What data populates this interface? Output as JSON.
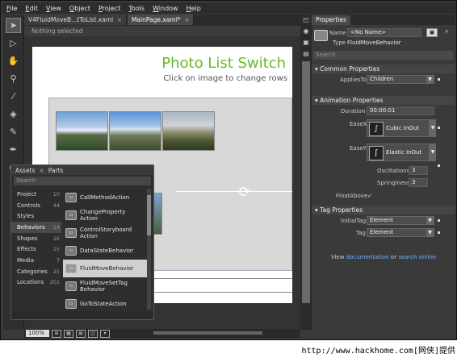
{
  "menubar": {
    "items": [
      {
        "key": "F",
        "rest": "ile"
      },
      {
        "key": "E",
        "rest": "dit"
      },
      {
        "key": "V",
        "rest": "iew"
      },
      {
        "key": "O",
        "rest": "bject"
      },
      {
        "key": "P",
        "rest": "roject"
      },
      {
        "key": "T",
        "rest": "ools"
      },
      {
        "key": "W",
        "rest": "indow"
      },
      {
        "key": "H",
        "rest": "elp"
      }
    ]
  },
  "document_tabs": [
    {
      "label": "V4FluidMoveB...tToList.xaml",
      "close": "×"
    },
    {
      "label": "MainPage.xaml*",
      "close": "×"
    }
  ],
  "breadcrumb": "Nothing selected",
  "artboard": {
    "title": "Photo List Switch",
    "subtitle": "Click on image to change rows"
  },
  "assets_panel": {
    "tabs": [
      "Assets",
      "×",
      "Parts"
    ],
    "search_placeholder": "Search",
    "categories": [
      {
        "label": "Project",
        "count": "10"
      },
      {
        "label": "Controls",
        "count": "44"
      },
      {
        "label": "Styles",
        "count": ""
      },
      {
        "label": "Behaviors",
        "count": "14"
      },
      {
        "label": "Shapes",
        "count": "26"
      },
      {
        "label": "Effects",
        "count": "15"
      },
      {
        "label": "Media",
        "count": "7"
      },
      {
        "label": "Categories",
        "count": "25"
      },
      {
        "label": "Locations",
        "count": "201"
      }
    ],
    "items": [
      "CallMethodAction",
      "ChangeProperty Action",
      "ControlStoryboard Action",
      "DataStateBehavior",
      "FluidMoveBehavior",
      "FluidMoveSetTag Behavior",
      "GoToStateAction"
    ],
    "selected_item": "FluidMoveBehavior"
  },
  "statusbar": {
    "zoom": "100%"
  },
  "properties": {
    "panel_title": "Properties",
    "name_label": "Name",
    "name_value": "<No Name>",
    "type_label": "Type",
    "type_value": "FluidMoveBehavior",
    "search_placeholder": "Search",
    "common": {
      "header": "Common Properties",
      "applies_to_label": "AppliesTo",
      "applies_to_value": "Children"
    },
    "animation": {
      "header": "Animation Properties",
      "duration_label": "Duration",
      "duration_value": "00:00:01",
      "easex_label": "EaseX",
      "easex_value": "Cubic InOut",
      "easey_label": "EaseY",
      "easey_value": "Elastic InOut",
      "oscillations_label": "Oscillations",
      "oscillations_value": "3",
      "springiness_label": "Springiness",
      "springiness_value": "3",
      "floatabove_label": "FloatAbove",
      "floatabove_value": "✓"
    },
    "tag": {
      "header": "Tag Properties",
      "initialtag_label": "InitialTag",
      "initialtag_value": "Element",
      "tag_label": "Tag",
      "tag_value": "Element"
    },
    "footer": {
      "prefix": "View ",
      "link1": "documentation",
      "middle": " or ",
      "link2": "search online"
    }
  },
  "watermark": "http://www.hackhome.com[网侠]提供"
}
